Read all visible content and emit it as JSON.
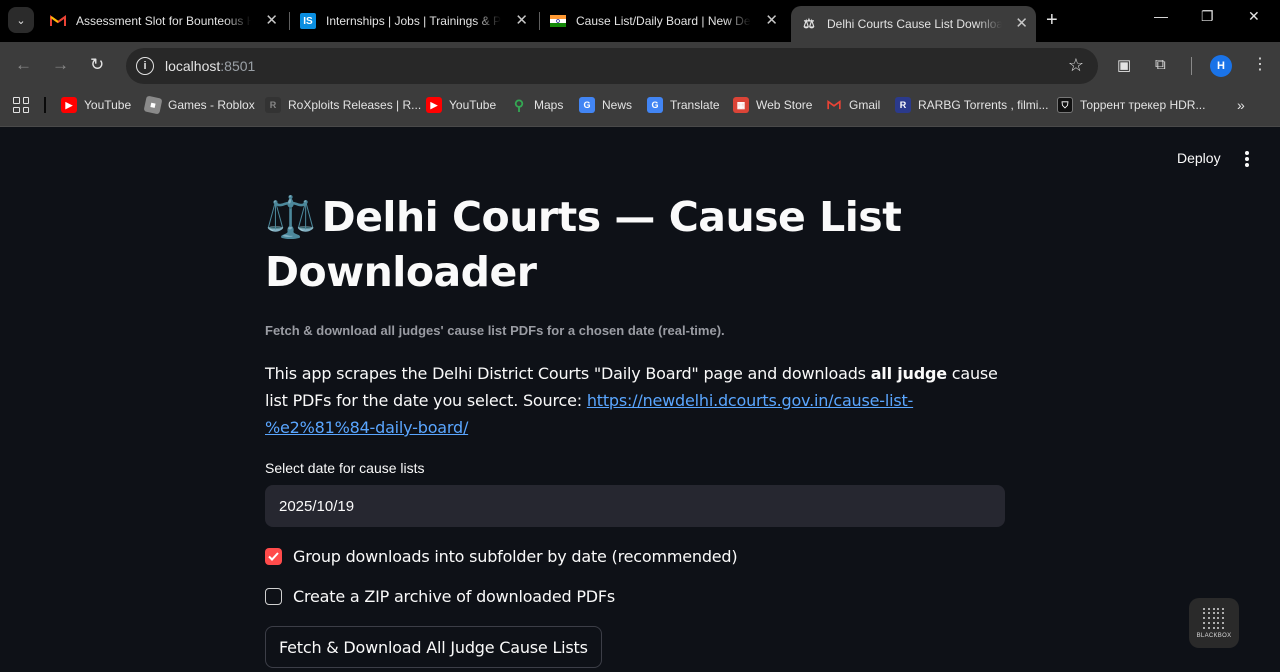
{
  "browser": {
    "tabs": [
      {
        "title": "Assessment Slot for Bounteous Hi",
        "favicon": "gmail-icon"
      },
      {
        "title": "Internships | Jobs | Trainings & Pla",
        "favicon": "internshala-icon"
      },
      {
        "title": "Cause List/Daily Board | New Delhi",
        "favicon": "india-flag-icon"
      },
      {
        "title": "Delhi Courts Cause List Downloader",
        "favicon": "scales-icon",
        "active": true
      }
    ],
    "address": {
      "host": "localhost",
      "port": ":8501"
    },
    "avatar_initial": "H",
    "bookmarks": [
      {
        "label": "YouTube",
        "icon": "youtube-icon",
        "color": "#ff0000"
      },
      {
        "label": "Games - Roblox",
        "icon": "roblox-icon",
        "color": "#8a8a8a"
      },
      {
        "label": "RoXploits Releases | R...",
        "icon": "roxploits-icon",
        "color": "#555555"
      },
      {
        "label": "YouTube",
        "icon": "youtube-icon",
        "color": "#ff0000"
      },
      {
        "label": "Maps",
        "icon": "maps-icon",
        "color": "#34a853"
      },
      {
        "label": "News",
        "icon": "news-icon",
        "color": "#4285f4"
      },
      {
        "label": "Translate",
        "icon": "translate-icon",
        "color": "#4285f4"
      },
      {
        "label": "Web Store",
        "icon": "webstore-icon",
        "color": "#db4437"
      },
      {
        "label": "Gmail",
        "icon": "gmail-icon",
        "color": "#ea4335"
      },
      {
        "label": "RARBG Torrents , filmi...",
        "icon": "rarbg-icon",
        "color": "#2b3a8c"
      },
      {
        "label": "Торрент трекер HDR...",
        "icon": "shield-icon",
        "color": "#222222"
      }
    ]
  },
  "app": {
    "header": {
      "deploy_label": "Deploy"
    },
    "title_emoji": "⚖️",
    "title": "Delhi Courts — Cause List Downloader",
    "subtitle": "Fetch & download all judges' cause list PDFs for a chosen date (real-time).",
    "description": {
      "part1": "This app scrapes the Delhi District Courts \"Daily Board\" page and downloads ",
      "bold": "all judge",
      "part2": " cause list PDFs for the date you select. Source: ",
      "link": "https://newdelhi.dcourts.gov.in/cause-list-%e2%81%84-daily-board/"
    },
    "date_label": "Select date for cause lists",
    "date_value": "2025/10/19",
    "checkboxes": [
      {
        "label": "Group downloads into subfolder by date (recommended)",
        "checked": true
      },
      {
        "label": "Create a ZIP archive of downloaded PDFs",
        "checked": false
      }
    ],
    "action_button": "Fetch & Download All Judge Cause Lists",
    "widget_label": "BLACKBOX",
    "accent_color": "#ff4b4b"
  }
}
